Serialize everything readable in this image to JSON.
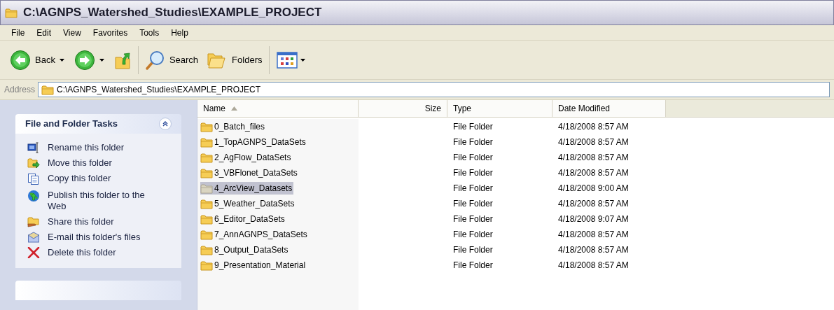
{
  "window": {
    "title": "C:\\AGNPS_Watershed_Studies\\EXAMPLE_PROJECT"
  },
  "menu": [
    "File",
    "Edit",
    "View",
    "Favorites",
    "Tools",
    "Help"
  ],
  "toolbar": {
    "back": "Back",
    "search": "Search",
    "folders": "Folders"
  },
  "address": {
    "label": "Address",
    "value": "C:\\AGNPS_Watershed_Studies\\EXAMPLE_PROJECT"
  },
  "tasks": {
    "title": "File and Folder Tasks",
    "expanded": true,
    "items": [
      {
        "kind": "rename",
        "label": "Rename this folder"
      },
      {
        "kind": "move",
        "label": "Move this folder"
      },
      {
        "kind": "copy",
        "label": "Copy this folder"
      },
      {
        "kind": "publish",
        "label": "Publish this folder to the Web"
      },
      {
        "kind": "share",
        "label": "Share this folder"
      },
      {
        "kind": "email",
        "label": "E-mail this folder's files"
      },
      {
        "kind": "delete",
        "label": "Delete this folder"
      }
    ]
  },
  "table": {
    "columns": [
      {
        "label": "Name",
        "sorted": true
      },
      {
        "label": "Size",
        "sorted": false
      },
      {
        "label": "Type",
        "sorted": false
      },
      {
        "label": "Date Modified",
        "sorted": false
      }
    ],
    "rows": [
      {
        "name": "0_Batch_files",
        "type": "File Folder",
        "date": "4/18/2008 8:57 AM",
        "selected": false
      },
      {
        "name": "1_TopAGNPS_DataSets",
        "type": "File Folder",
        "date": "4/18/2008 8:57 AM",
        "selected": false
      },
      {
        "name": "2_AgFlow_DataSets",
        "type": "File Folder",
        "date": "4/18/2008 8:57 AM",
        "selected": false
      },
      {
        "name": "3_VBFlonet_DataSets",
        "type": "File Folder",
        "date": "4/18/2008 8:57 AM",
        "selected": false
      },
      {
        "name": "4_ArcView_Datasets",
        "type": "File Folder",
        "date": "4/18/2008 9:00 AM",
        "selected": true
      },
      {
        "name": "5_Weather_DataSets",
        "type": "File Folder",
        "date": "4/18/2008 8:57 AM",
        "selected": false
      },
      {
        "name": "6_Editor_DataSets",
        "type": "File Folder",
        "date": "4/18/2008 9:07 AM",
        "selected": false
      },
      {
        "name": "7_AnnAGNPS_DataSets",
        "type": "File Folder",
        "date": "4/18/2008 8:57 AM",
        "selected": false
      },
      {
        "name": "8_Output_DataSets",
        "type": "File Folder",
        "date": "4/18/2008 8:57 AM",
        "selected": false
      },
      {
        "name": "9_Presentation_Material",
        "type": "File Folder",
        "date": "4/18/2008 8:57 AM",
        "selected": false
      }
    ]
  }
}
